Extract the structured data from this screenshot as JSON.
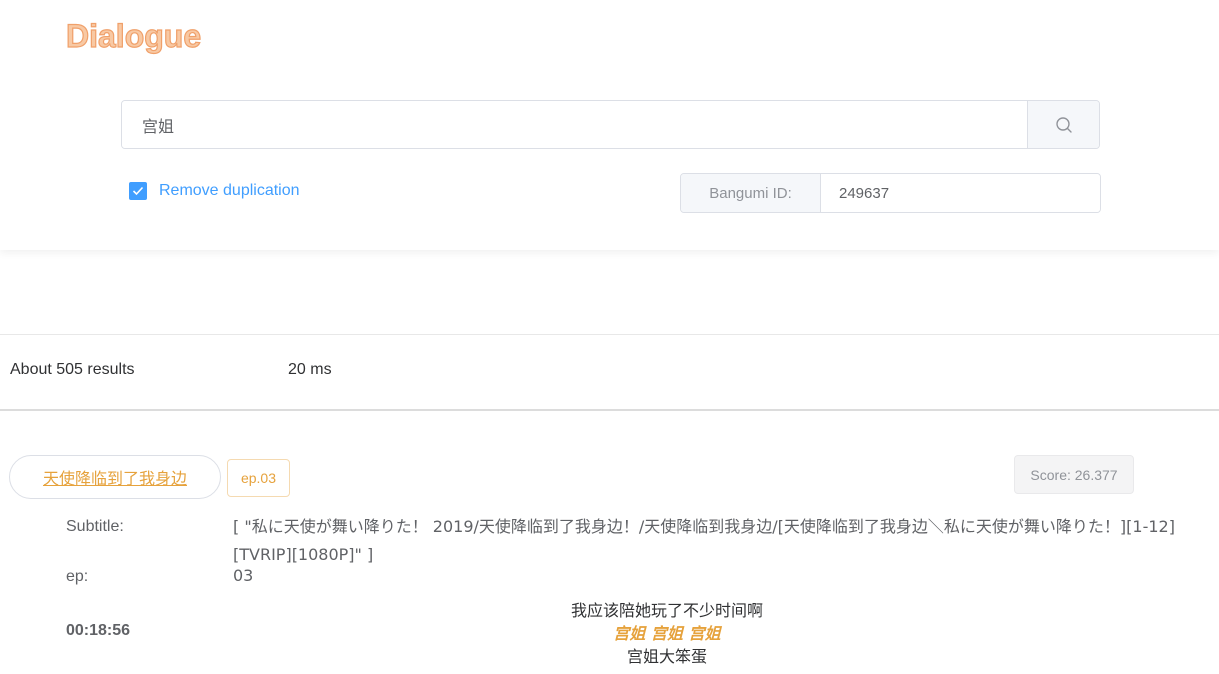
{
  "app": {
    "logo": "Dialogue"
  },
  "search": {
    "query": "宫姐"
  },
  "options": {
    "remove_duplication_label": "Remove duplication",
    "remove_duplication_checked": true,
    "bangumi_label": "Bangumi ID:",
    "bangumi_value": "249637"
  },
  "stats": {
    "results": "About 505 results",
    "time": "20 ms"
  },
  "result": {
    "title": "天使降临到了我身边",
    "ep_tag": "ep.03",
    "score": "Score: 26.377",
    "subtitle_label": "Subtitle:",
    "subtitle_value": "[ \"私に天使が舞い降りた！ 2019/天使降临到了我身边！/天使降临到我身边/[天使降临到了我身边＼私に天使が舞い降りた！][1-12][TVRIP][1080P]\" ]",
    "ep_label": "ep:",
    "ep_value": "03",
    "time": "00:18:56",
    "lines": {
      "prev": "我应该陪她玩了不少时间啊",
      "match": "宫姐 宫姐 宫姐",
      "next": "宫姐大笨蛋"
    }
  },
  "colors": {
    "accent": "#409eff",
    "highlight": "#e6a23c",
    "logo": "#f0a06a"
  }
}
